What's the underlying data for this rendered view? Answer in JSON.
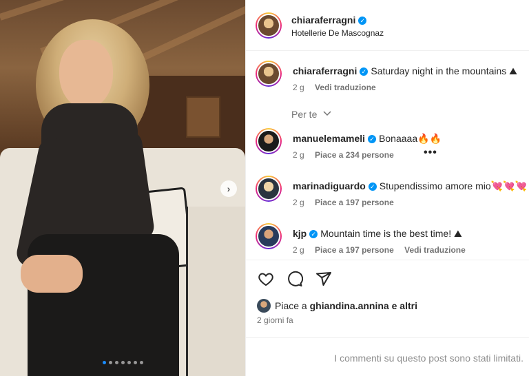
{
  "post": {
    "author": "chiaraferragni",
    "location": "Hotellerie De Mascognaz",
    "photo_index": 1,
    "photo_count": 7
  },
  "caption": {
    "username": "chiaraferragni",
    "text": "Saturday night in the mountains ⛰",
    "time": "2 g",
    "translate": "Vedi traduzione"
  },
  "for_you_label": "Per te",
  "comments": [
    {
      "username": "manuelemameli",
      "text": "Bonaaaa🔥🔥",
      "time": "2 g",
      "likes": "Piace a 234 persone",
      "more": "•••"
    },
    {
      "username": "marinadiguardo",
      "text": "Stupendissimo amore mio💘💘💘",
      "time": "2 g",
      "likes": "Piace a 197 persone"
    },
    {
      "username": "kjp",
      "text": "Mountain time is the best time! ⛰",
      "time": "2 g",
      "likes": "Piace a 197 persone",
      "translate": "Vedi traduzione"
    }
  ],
  "likes_summary": {
    "prefix": "Piace a",
    "user": "ghiandina.annina",
    "suffix": "e altri"
  },
  "posted_ago": "2 giorni fa",
  "comments_limited": "I commenti su questo post sono stati limitati.",
  "colors": {
    "verified": "#0095f6",
    "secondary_text": "#737373"
  }
}
